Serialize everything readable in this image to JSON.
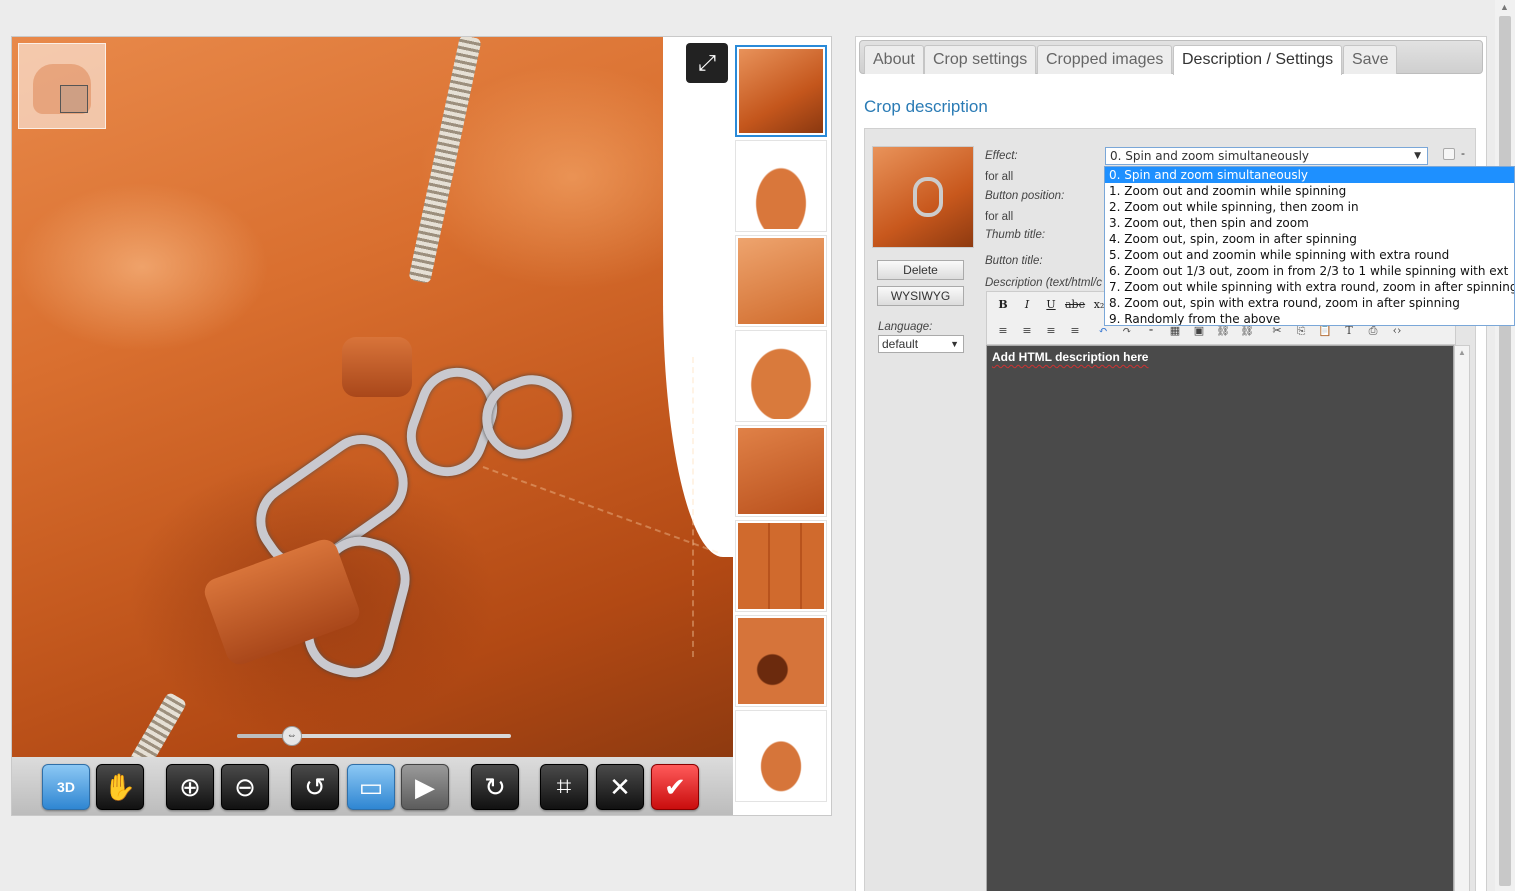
{
  "viewer": {
    "fullscreen_icon": "expand-arrows-icon",
    "slider_position": 0.2,
    "toolbar": [
      {
        "name": "3d-spin-button",
        "icon": "3D",
        "style": "blue"
      },
      {
        "name": "pan-hand-button",
        "icon": "✋",
        "style": "dark"
      },
      {
        "name": "zoom-in-button",
        "icon": "⊕",
        "style": "dark"
      },
      {
        "name": "zoom-out-button",
        "icon": "⊖",
        "style": "dark"
      },
      {
        "name": "rotate-left-button",
        "icon": "↺",
        "style": "dark"
      },
      {
        "name": "screen-button",
        "icon": "▭",
        "style": "blue"
      },
      {
        "name": "play-button",
        "icon": "▶",
        "style": "gray"
      },
      {
        "name": "rotate-right-button",
        "icon": "↻",
        "style": "dark"
      },
      {
        "name": "crop-button",
        "icon": "⌗",
        "style": "dark"
      },
      {
        "name": "settings-tools-button",
        "icon": "✕",
        "style": "dark"
      },
      {
        "name": "confirm-button",
        "icon": "✔",
        "style": "red"
      }
    ],
    "thumbnails": 8
  },
  "tabs": [
    "About",
    "Crop settings",
    "Cropped images",
    "Description / Settings",
    "Save"
  ],
  "active_tab": 3,
  "section_title": "Crop description",
  "form": {
    "delete_label": "Delete",
    "wysiwyg_label": "WYSIWYG",
    "language_label": "Language:",
    "language_value": "default",
    "effect_label": "Effect:",
    "for_all_1": "for all",
    "button_position_label": "Button position:",
    "for_all_2": "for all",
    "thumb_title_label": "Thumb title:",
    "button_title_label": "Button title:",
    "description_label": "Description (text/html/c",
    "effect_value": "0. Spin and zoom simultaneously",
    "dash": "-",
    "editor_placeholder": "Add HTML description here"
  },
  "effect_options": [
    "0. Spin and zoom simultaneously",
    "1. Zoom out and zoomin while spinning",
    "2. Zoom out while spinning, then zoom in",
    "3. Zoom out, then spin and zoom",
    "4. Zoom out, spin, zoom in after spinning",
    "5. Zoom out and zoomin while spinning with extra round",
    "6. Zoom out 1/3 out, zoom in from 2/3 to 1 while spinning with ext",
    "7. Zoom out while spinning with extra round, zoom in after spinning",
    "8. Zoom out, spin with extra round, zoom in after spinning",
    "9. Randomly from the above"
  ],
  "selected_option": 0,
  "editor_toolbar_row1": [
    "B",
    "I",
    "U",
    "abe",
    "x₂"
  ],
  "editor_toolbar_row2": [
    "≡",
    "≡",
    "≡",
    "≡",
    "↶",
    "↷",
    "⁃",
    "▦",
    "▣",
    "⛓",
    "⛓",
    "✂",
    "⎘",
    "📋",
    "T",
    "⎙",
    "‹›"
  ]
}
